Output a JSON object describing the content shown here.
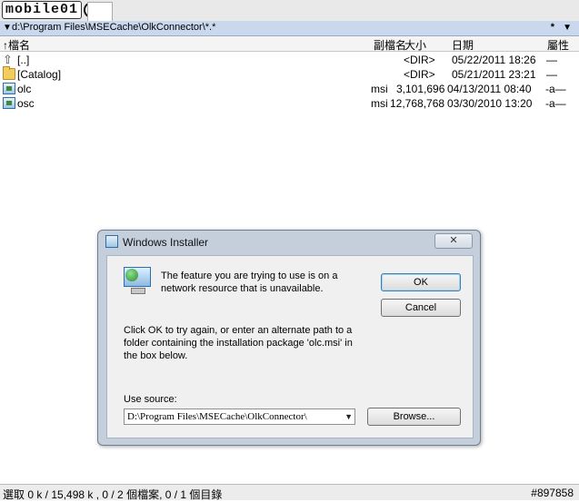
{
  "logo": {
    "text": "mobile01"
  },
  "pathbar": {
    "path": "d:\\Program Files\\MSECache\\OlkConnector\\*.*",
    "filter": "*"
  },
  "columns": {
    "name": "↑檔名",
    "ext": "副檔名",
    "size": "大小",
    "date": "日期",
    "attr": "屬性"
  },
  "files": [
    {
      "icon": "up-dir-icon",
      "name": "[..]",
      "ext": "",
      "size": "<DIR>",
      "date": "05/22/2011 18:26",
      "attr": "—"
    },
    {
      "icon": "folder-icon",
      "name": "[Catalog]",
      "ext": "",
      "size": "<DIR>",
      "date": "05/21/2011 23:21",
      "attr": "—"
    },
    {
      "icon": "msi-file-icon",
      "name": "olc",
      "ext": "msi",
      "size": "3,101,696",
      "date": "04/13/2011 08:40",
      "attr": "-a—"
    },
    {
      "icon": "msi-file-icon",
      "name": "osc",
      "ext": "msi",
      "size": "12,768,768",
      "date": "03/30/2010 13:20",
      "attr": "-a—"
    }
  ],
  "dialog": {
    "title": "Windows Installer",
    "close": "✕",
    "message1": "The feature you are trying to use is on a network resource that is unavailable.",
    "message2": "Click OK to try again, or enter an alternate path to a folder containing the installation package 'olc.msi' in the box below.",
    "source_label": "Use source:",
    "source_value": "D:\\Program Files\\MSECache\\OlkConnector\\",
    "ok": "OK",
    "cancel": "Cancel",
    "browse": "Browse..."
  },
  "status": {
    "text": "選取 0 k / 15,498 k , 0 / 2 個檔案, 0 / 1 個目錄",
    "count": "#897858"
  },
  "colors": {
    "pathbar": "#c9d8ec",
    "dialog_frame": "#c4cfdb",
    "dialog_body": "#f0f0f0"
  }
}
